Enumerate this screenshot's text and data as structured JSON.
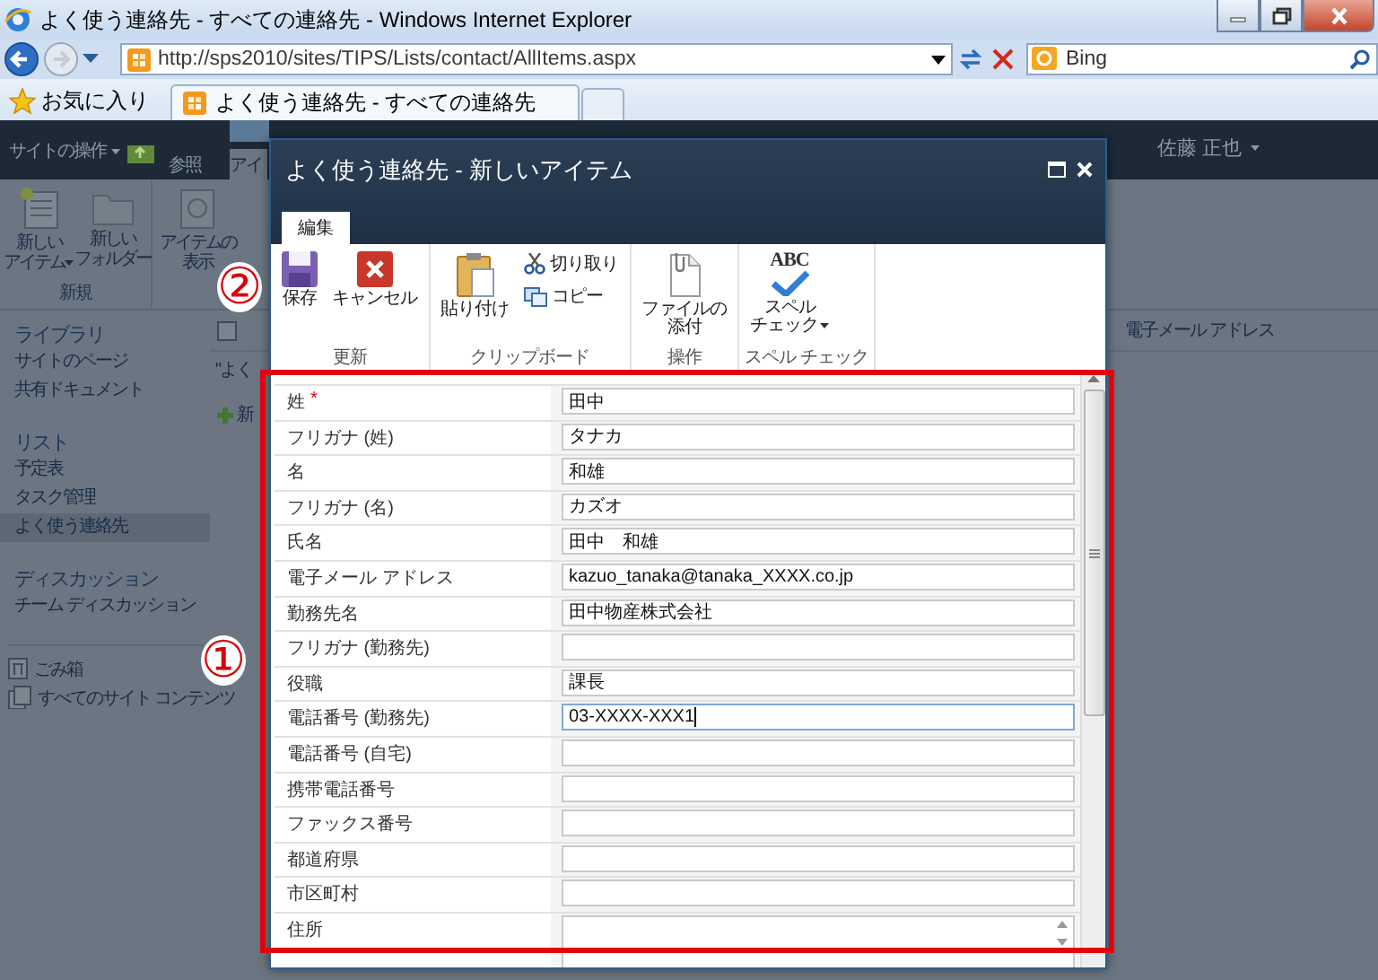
{
  "browser": {
    "title": "よく使う連絡先 - すべての連絡先 - Windows Internet Explorer",
    "address": "http://sps2010/sites/TIPS/Lists/contact/AllItems.aspx",
    "search_placeholder": "Bing",
    "favorites": "お気に入り",
    "tabs": [
      {
        "label": "よく使う連絡先 - すべての連絡先",
        "selected": true
      }
    ]
  },
  "site": {
    "site_actions": "サイトの操作",
    "tabs": [
      {
        "label": "参照",
        "selected": false
      },
      {
        "label": "アイ",
        "selected": true
      }
    ],
    "user": "佐藤 正也",
    "ribbon": [
      {
        "lines": [
          "新しい",
          "アイテム"
        ],
        "kind": "new-item",
        "menu": true
      },
      {
        "lines": [
          "新しい",
          "フォルダー"
        ],
        "kind": "new-folder",
        "menu": false
      },
      {
        "lines": [
          "アイテムの",
          "表示"
        ],
        "kind": "view",
        "menu": false
      }
    ],
    "ribbon_group": "新規",
    "nav": [
      {
        "heading": "ライブラリ",
        "items": [
          {
            "label": "サイトのページ",
            "selected": false
          },
          {
            "label": "共有ドキュメント",
            "selected": false
          }
        ]
      },
      {
        "heading": "リスト",
        "items": [
          {
            "label": "予定表",
            "selected": false
          },
          {
            "label": "タスク管理",
            "selected": false
          },
          {
            "label": "よく使う連絡先",
            "selected": true
          }
        ]
      },
      {
        "heading": "ディスカッション",
        "items": [
          {
            "label": "チーム ディスカッション",
            "selected": false
          }
        ]
      }
    ],
    "nav_footer": [
      {
        "label": "ごみ箱",
        "kind": "recycle"
      },
      {
        "label": "すべてのサイト コンテンツ",
        "kind": "contents"
      }
    ],
    "list": {
      "checked": false,
      "column": "電子メール アドレス",
      "title": "\"よく",
      "new_link": "新"
    }
  },
  "dialog": {
    "title": "よく使う連絡先 - 新しいアイテム",
    "tabs": [
      {
        "label": "編集",
        "selected": true
      }
    ],
    "groups": [
      {
        "label": "更新",
        "buttons": [
          {
            "lines": [
              "保存"
            ],
            "kind": "save",
            "menu": false
          },
          {
            "lines": [
              "キャンセル"
            ],
            "kind": "cancel",
            "menu": false
          }
        ]
      },
      {
        "label": "クリップボード",
        "buttons": [
          {
            "lines": [
              "貼り付け"
            ],
            "kind": "paste",
            "menu": false
          },
          {
            "lines": [
              "切り取り"
            ],
            "kind": "cut",
            "menu": false
          },
          {
            "lines": [
              "コピー"
            ],
            "kind": "copy",
            "menu": false
          }
        ]
      },
      {
        "label": "操作",
        "buttons": [
          {
            "lines": [
              "ファイルの",
              "添付"
            ],
            "kind": "attach",
            "menu": false
          }
        ]
      },
      {
        "label": "スペル チェック",
        "buttons": [
          {
            "lines": [
              "スペル",
              "チェック"
            ],
            "kind": "spell",
            "icon_text": "ABC",
            "menu": true
          }
        ]
      }
    ],
    "fields": [
      {
        "label": "姓",
        "required_mark": "*",
        "value": "田中",
        "kind": "text",
        "focused": false
      },
      {
        "label": "フリガナ (姓)",
        "value": "タナカ",
        "kind": "text",
        "focused": false
      },
      {
        "label": "名",
        "value": "和雄",
        "kind": "text",
        "focused": false
      },
      {
        "label": "フリガナ (名)",
        "value": "カズオ",
        "kind": "text",
        "focused": false
      },
      {
        "label": "氏名",
        "value": "田中　和雄",
        "kind": "text",
        "focused": false
      },
      {
        "label": "電子メール アドレス",
        "value": "kazuo_tanaka@tanaka_XXXX.co.jp",
        "kind": "text",
        "focused": false
      },
      {
        "label": "勤務先名",
        "value": "田中物産株式会社",
        "kind": "text",
        "focused": false
      },
      {
        "label": "フリガナ (勤務先)",
        "kind": "text",
        "focused": false
      },
      {
        "label": "役職",
        "value": "課長",
        "kind": "text",
        "focused": false
      },
      {
        "label": "電話番号 (勤務先)",
        "value": "03-XXXX-XXX1",
        "kind": "text",
        "focused": true
      },
      {
        "label": "電話番号 (自宅)",
        "kind": "text",
        "focused": false
      },
      {
        "label": "携帯電話番号",
        "kind": "text",
        "focused": false
      },
      {
        "label": "ファックス番号",
        "kind": "text",
        "focused": false
      },
      {
        "label": "都道府県",
        "kind": "text",
        "focused": false
      },
      {
        "label": "市区町村",
        "kind": "text",
        "focused": false
      },
      {
        "label": "住所",
        "kind": "multiline",
        "focused": false
      }
    ]
  },
  "annotations": [
    {
      "label": "②"
    },
    {
      "label": "①"
    }
  ]
}
